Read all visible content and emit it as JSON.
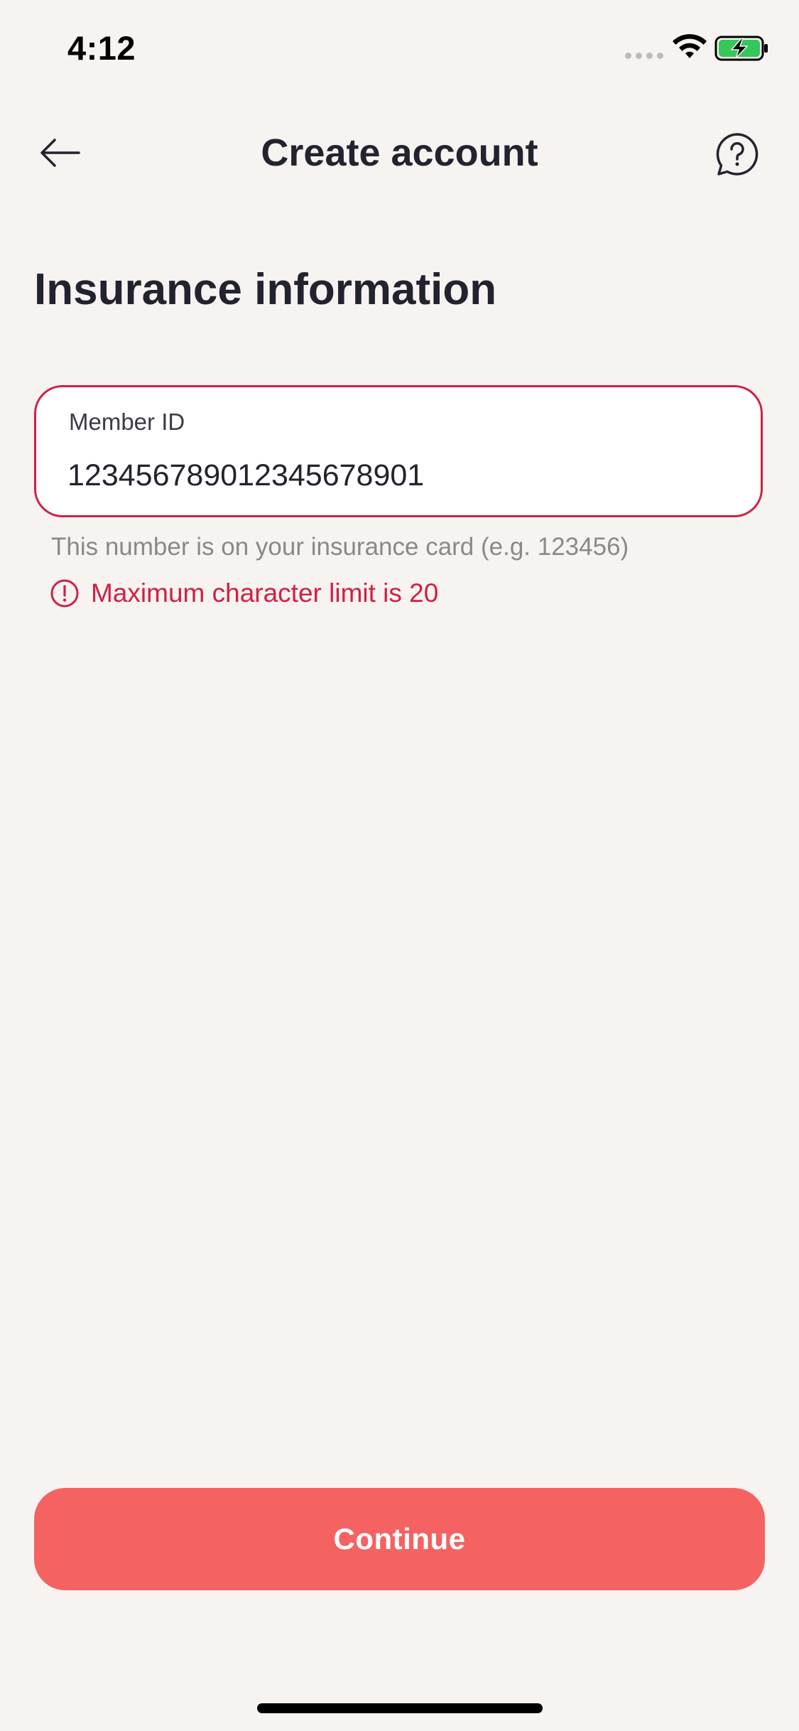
{
  "status_bar": {
    "time": "4:12"
  },
  "nav": {
    "title": "Create account",
    "back_icon": "arrow-left-icon",
    "help_icon": "help-bubble-icon"
  },
  "heading": "Insurance information",
  "member_id": {
    "label": "Member ID",
    "value": "123456789012345678901",
    "helper": "This number is on your insurance card (e.g. 123456)",
    "error": "Maximum character limit is 20"
  },
  "continue_label": "Continue",
  "colors": {
    "background": "#F7F3F1",
    "error": "#D02045",
    "primary_button": "#F46262",
    "text": "#23232F",
    "battery": "#34C759"
  }
}
